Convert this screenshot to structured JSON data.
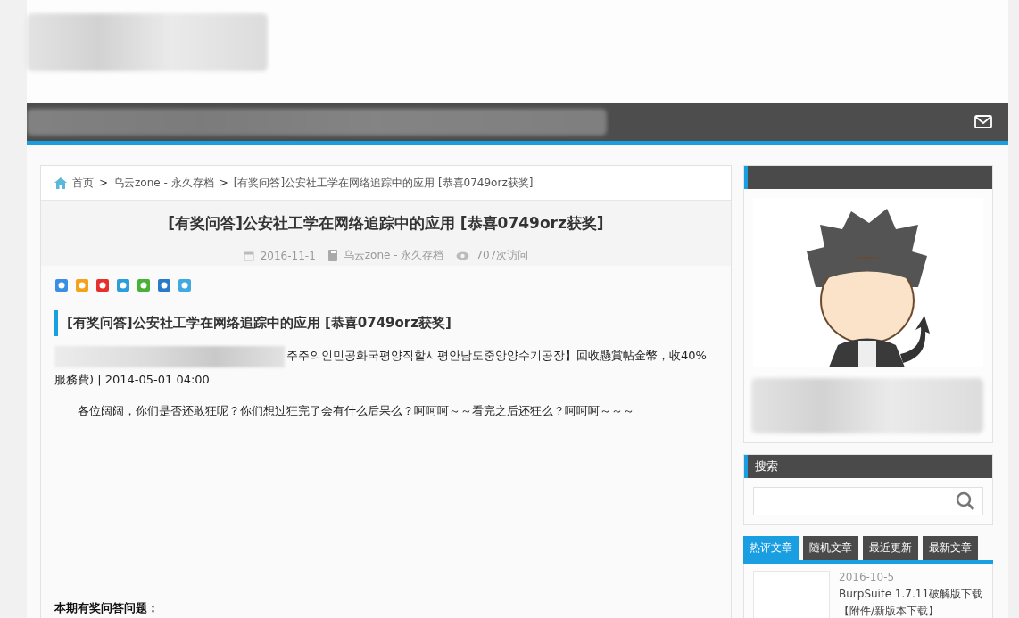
{
  "breadcrumb": [
    {
      "kind": "home",
      "label": "首页"
    },
    {
      "kind": "separator",
      "label": ">"
    },
    {
      "kind": "link",
      "label": "乌云zone - 永久存档"
    },
    {
      "kind": "separator",
      "label": ">"
    },
    {
      "kind": "current",
      "label": "[有奖问答]公安社工学在网络追踪中的应用 [恭喜0749orz获奖]"
    }
  ],
  "article": {
    "title": "[有奖问答]公安社工学在网络追踪中的应用 [恭喜0749orz获奖]",
    "meta": {
      "date": "2016-11-1",
      "category": "乌云zone - 永久存档",
      "views": "707次访问"
    },
    "heading": "[有奖问答]公安社工学在网络追踪中的应用 [恭喜0749orz获奖]",
    "paragraphs": [
      {
        "redacted": true,
        "indent": false,
        "text": "주주의인민공화국평양직할시평안남도중앙양수기공장】回收懸賞帖金幣，收40%服務費) | 2014-05-01 04:00"
      },
      {
        "redacted": false,
        "indent": true,
        "text": "各位阔阔，你们是否还敢狂呢？你们想过狂完了会有什么后果么？呵呵呵～～看完之后还狂么？呵呵呵～～～"
      }
    ],
    "question": "本期有奖问答问题："
  },
  "search": {
    "title": "搜索"
  },
  "tabs": [
    {
      "label": "热评文章",
      "selected": true
    },
    {
      "label": "随机文章",
      "selected": false
    },
    {
      "label": "最近更新",
      "selected": false
    },
    {
      "label": "最新文章",
      "selected": false
    }
  ],
  "posts": [
    {
      "date": "2016-10-5",
      "title": "BurpSuite 1.7.11破解版下载【附件/新版本下载】"
    }
  ]
}
